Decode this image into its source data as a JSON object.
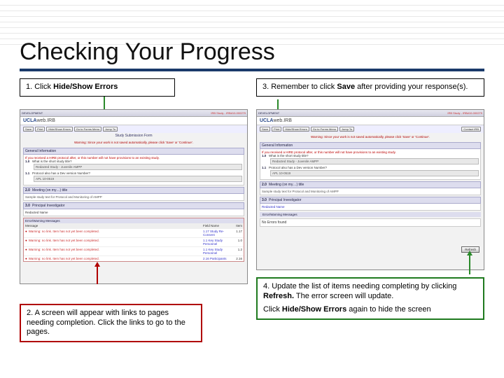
{
  "title": "Checking Your Progress",
  "steps": {
    "s1": {
      "prefix": "1. Click ",
      "bold": "Hide/Show Errors"
    },
    "s2": "2. A screen will appear with links to pages needing completion. Click the links to go to the pages.",
    "s3": {
      "prefix": "3. Remember to click ",
      "bold": "Save",
      "suffix": " after providing your response(s)."
    },
    "s4a": {
      "prefix": "4. Update the list of items needing completing by clicking ",
      "bold": "Refresh.",
      "suffix": " The error screen will update."
    },
    "s4b": {
      "prefix": "Click ",
      "bold": "Hide/Show Errors",
      "suffix": " again to hide the screen"
    }
  },
  "shot": {
    "devlabel": "DEVELOPMENT",
    "topright": "IRB Study - IRB#10-000279",
    "logo_brand": "UCLA",
    "logo_sub": "web.IRB",
    "buttons": [
      "Save",
      "Print",
      "Hide/Show Errors",
      "Go to Forms Menu",
      "Jump To"
    ],
    "title_line": "Study Submission Form",
    "warning": "Warning: Since your work is not saved automatically, please click 'Save' or 'Continue'.",
    "sec_general": "General Information",
    "sec_general_note": "If you received a HIRE protocol after, or this number will not have provisions to an existing study.",
    "q1": "What is the short study title?",
    "a1": "Redacted Study - Juvenile AMPP",
    "q1_1": "Protocol also has a Dev version Number?",
    "a1_1": "APL 10-0519",
    "q2": "Meeting (on my…) title",
    "a2": "Sample study text for Protocol and Monitoring of AMPP",
    "q3": "Principal Investigator",
    "a3": "Redacted Name",
    "contact_irb": "Contact IRB",
    "err_header": "Error/Warning Messages",
    "msg_col": "Message",
    "ref_col": "Field Name",
    "item_col": "Item",
    "errs": [
      {
        "m": "Warning: no link. Item has not yet been completed.",
        "f": "1.17 Study Re-Consent",
        "i": "1.17"
      },
      {
        "m": "Warning: no link. Item has not yet been completed.",
        "f": "1.1 Key Study Personnel",
        "i": "1.0"
      },
      {
        "m": "Warning: no link. Item has not yet been completed.",
        "f": "1.1 Key Study Personnel",
        "i": "1.2"
      },
      {
        "m": "Warning: no link. Item has not yet been completed.",
        "f": "2.16 Participants",
        "i": "2.16"
      }
    ],
    "refresh": "Refresh",
    "no_errors": "No Errors found"
  }
}
